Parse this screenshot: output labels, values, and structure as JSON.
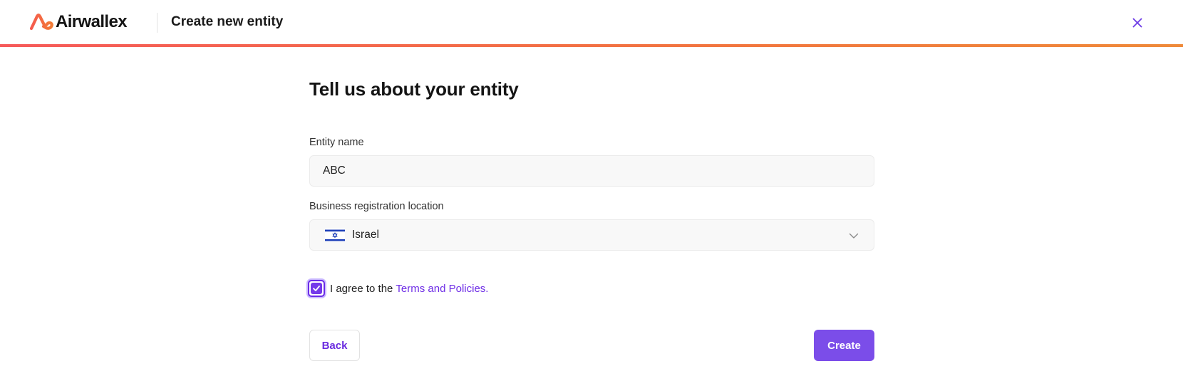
{
  "header": {
    "brand_name": "Airwallex",
    "page_title": "Create new entity",
    "accent_color": "#f2753f"
  },
  "form": {
    "heading": "Tell us about your entity",
    "entity_name": {
      "label": "Entity name",
      "value": "ABC"
    },
    "registration_location": {
      "label": "Business registration location",
      "value": "Israel",
      "flag": "israel-flag-icon"
    },
    "agreement": {
      "checked": true,
      "text": "I agree to the",
      "link_text": "Terms and Policies."
    },
    "buttons": {
      "back_label": "Back",
      "create_label": "Create"
    },
    "primary_color": "#7b4de9"
  }
}
